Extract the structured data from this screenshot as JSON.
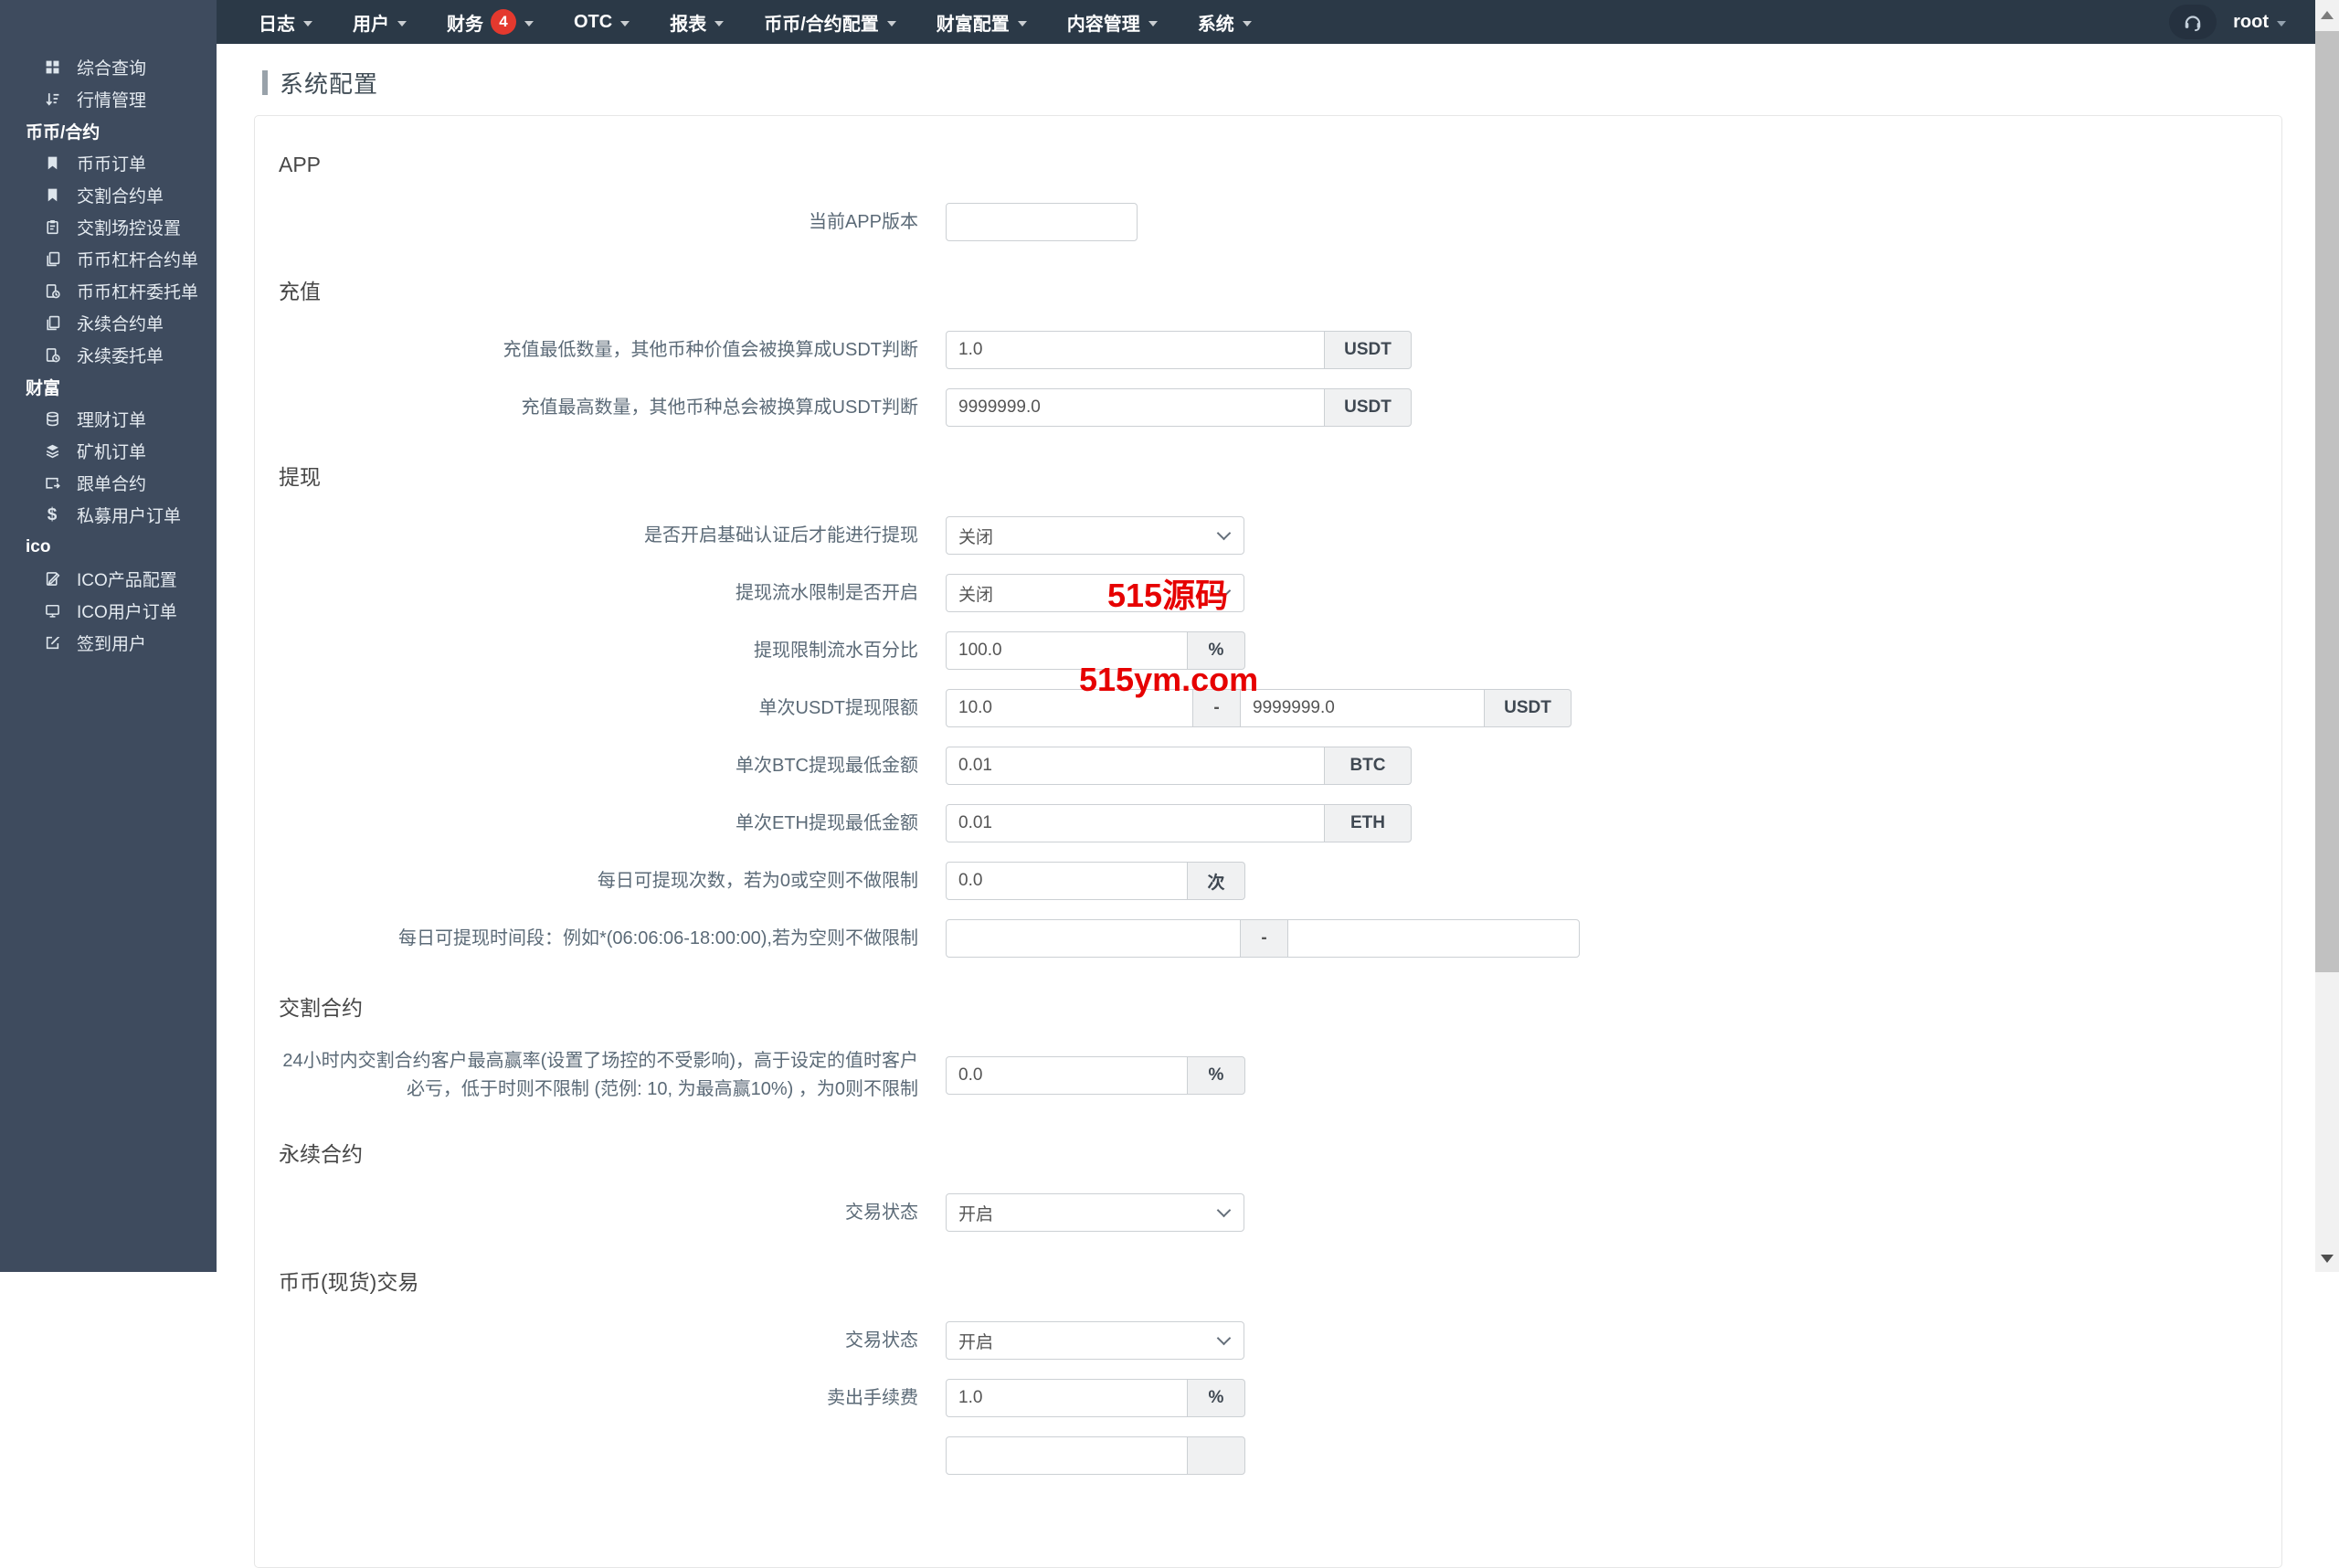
{
  "navbar": {
    "items": [
      {
        "label": "日志"
      },
      {
        "label": "用户"
      },
      {
        "label": "财务",
        "badge": "4"
      },
      {
        "label": "OTC"
      },
      {
        "label": "报表"
      },
      {
        "label": "币币/合约配置"
      },
      {
        "label": "财富配置"
      },
      {
        "label": "内容管理"
      },
      {
        "label": "系统"
      }
    ],
    "user": "root"
  },
  "sidebar": {
    "items": [
      {
        "label": "综合查询"
      },
      {
        "label": "行情管理"
      },
      {
        "label": "币币/合约"
      },
      {
        "label": "币币订单"
      },
      {
        "label": "交割合约单"
      },
      {
        "label": "交割场控设置"
      },
      {
        "label": "币币杠杆合约单"
      },
      {
        "label": "币币杠杆委托单"
      },
      {
        "label": "永续合约单"
      },
      {
        "label": "永续委托单"
      },
      {
        "label": "财富"
      },
      {
        "label": "理财订单"
      },
      {
        "label": "矿机订单"
      },
      {
        "label": "跟单合约"
      },
      {
        "label": "私募用户订单"
      },
      {
        "label": "ico"
      },
      {
        "label": "ICO产品配置"
      },
      {
        "label": "ICO用户订单"
      },
      {
        "label": "签到用户"
      }
    ],
    "dollar_glyph": "$"
  },
  "page": {
    "title": "系统配置"
  },
  "watermark": {
    "line1": "515源码",
    "line2": "515ym.com",
    "color": "#e60000"
  },
  "form": {
    "sections": [
      {
        "heading": "APP",
        "rows": [
          {
            "label": "当前APP版本",
            "value": ""
          }
        ]
      },
      {
        "heading": "充值",
        "rows": [
          {
            "label": "充值最低数量，其他币种价值会被换算成USDT判断",
            "value": "1.0",
            "addon": "USDT"
          },
          {
            "label": "充值最高数量，其他币种总会被换算成USDT判断",
            "value": "9999999.0",
            "addon": "USDT"
          }
        ]
      },
      {
        "heading": "提现",
        "rows": [
          {
            "label": "是否开启基础认证后才能进行提现",
            "value": "关闭"
          },
          {
            "label": "提现流水限制是否开启",
            "value": "关闭"
          },
          {
            "label": "提现限制流水百分比",
            "value": "100.0",
            "addon": "%"
          },
          {
            "label": "单次USDT提现限额",
            "value1": "10.0",
            "sep": "-",
            "value2": "9999999.0",
            "addon": "USDT"
          },
          {
            "label": "单次BTC提现最低金额",
            "value": "0.01",
            "addon": "BTC"
          },
          {
            "label": "单次ETH提现最低金额",
            "value": "0.01",
            "addon": "ETH"
          },
          {
            "label": "每日可提现次数，若为0或空则不做限制",
            "value": "0.0",
            "addon": "次"
          },
          {
            "label": "每日可提现时间段：例如*(06:06:06-18:00:00),若为空则不做限制",
            "value1": "",
            "sep": "-",
            "value2": ""
          }
        ]
      },
      {
        "heading": "交割合约",
        "rows": [
          {
            "label": "24小时内交割合约客户最高赢率(设置了场控的不受影响)，高于设定的值时客户必亏，低于时则不限制 (范例: 10, 为最高赢10%) ，为0则不限制",
            "value": "0.0",
            "addon": "%"
          }
        ]
      },
      {
        "heading": "永续合约",
        "rows": [
          {
            "label": "交易状态",
            "value": "开启"
          }
        ]
      },
      {
        "heading": "币币(现货)交易",
        "rows": [
          {
            "label": "交易状态",
            "value": "开启"
          },
          {
            "label": "卖出手续费",
            "value": "1.0",
            "addon": "%"
          },
          {
            "label": "",
            "value": "",
            "addon": ""
          }
        ]
      }
    ]
  }
}
